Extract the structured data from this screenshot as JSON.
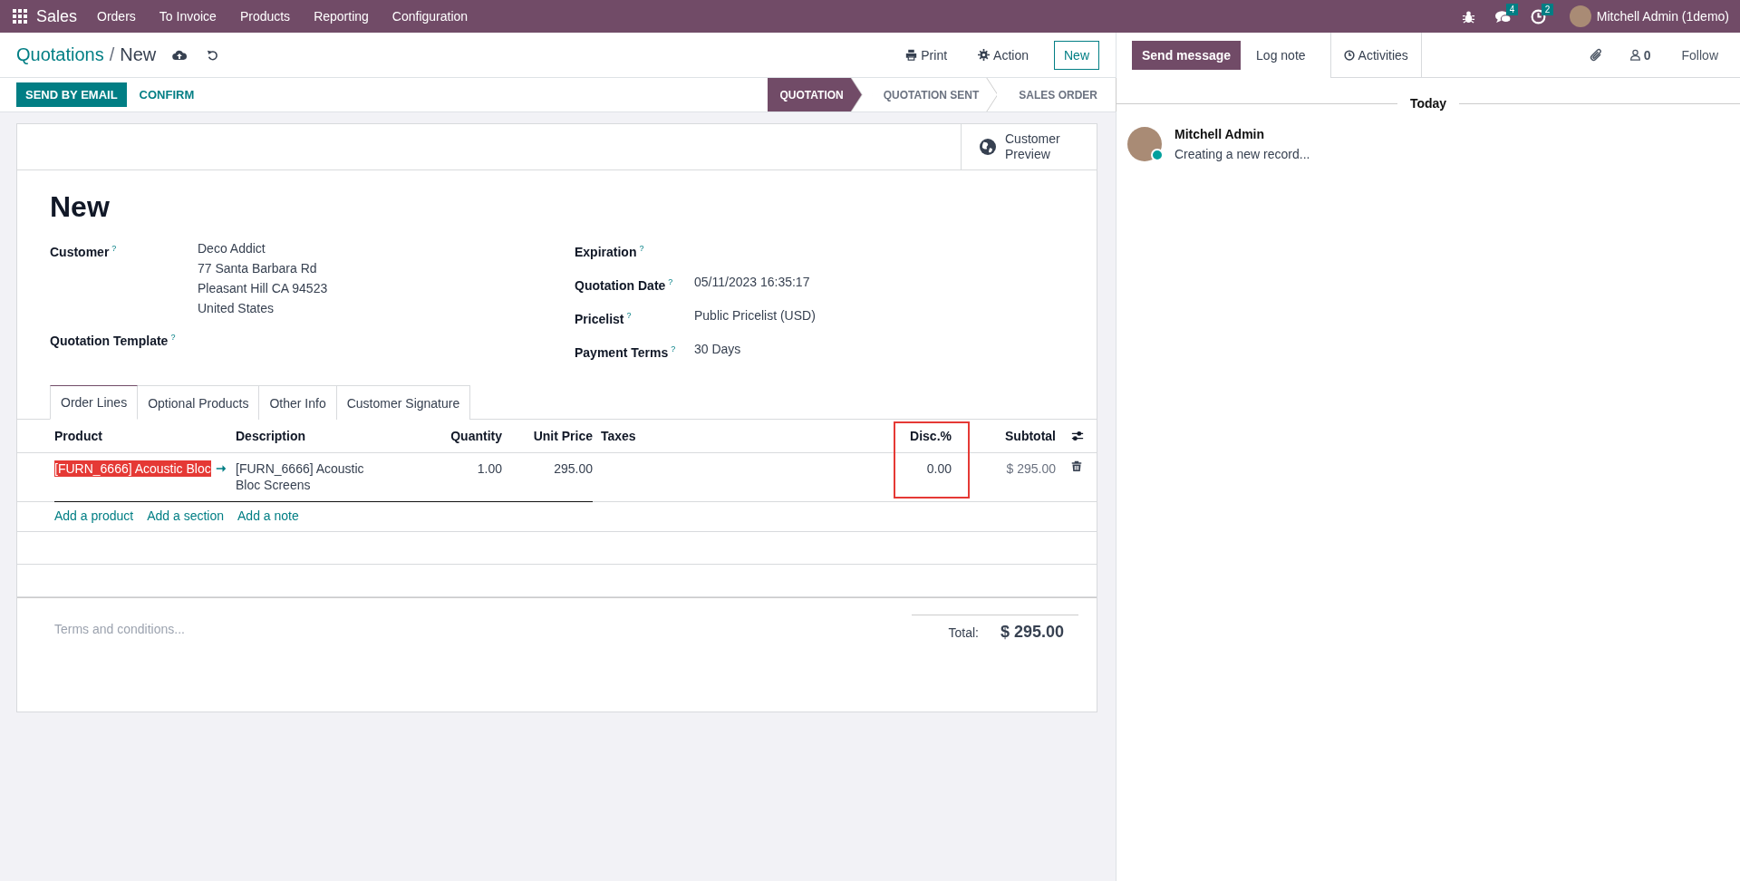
{
  "navbar": {
    "app": "Sales",
    "menu": [
      "Orders",
      "To Invoice",
      "Products",
      "Reporting",
      "Configuration"
    ],
    "badges": [
      {
        "kind": "messages",
        "count": "4"
      },
      {
        "kind": "activities",
        "count": "2"
      }
    ],
    "user": "Mitchell Admin (1demo)"
  },
  "breadcrumb": {
    "parent": "Quotations",
    "separator": "/",
    "current": "New"
  },
  "actions": {
    "print": "Print",
    "action": "Action",
    "new": "New"
  },
  "status_buttons": [
    {
      "label": "SEND BY EMAIL",
      "primary": true
    },
    {
      "label": "CONFIRM",
      "primary": false
    }
  ],
  "stages": [
    {
      "label": "QUOTATION",
      "selected": true
    },
    {
      "label": "QUOTATION SENT",
      "selected": false
    },
    {
      "label": "SALES ORDER",
      "selected": false
    }
  ],
  "button_box": {
    "label": "Customer Preview"
  },
  "title": "New",
  "left_fields": [
    {
      "label": "Customer",
      "help": "?",
      "value_lines": [
        "Deco Addict",
        "77 Santa Barbara Rd",
        "Pleasant Hill CA 94523",
        "United States"
      ]
    },
    {
      "label": "Quotation Template",
      "help": "?"
    }
  ],
  "right_fields": [
    {
      "label": "Expiration",
      "help": "?"
    },
    {
      "label": "Quotation Date",
      "help": "?",
      "value_lines": [
        "05/11/2023 16:35:17"
      ]
    },
    {
      "label": "Pricelist",
      "help": "?",
      "value_lines": [
        "Public Pricelist (USD)"
      ]
    },
    {
      "label": "Payment Terms",
      "help": "?",
      "value_lines": [
        "30 Days"
      ]
    }
  ],
  "tabs": [
    {
      "label": "Order Lines",
      "selected": true
    },
    {
      "label": "Optional Products",
      "selected": false
    },
    {
      "label": "Other Info",
      "selected": false
    },
    {
      "label": "Customer Signature",
      "selected": false
    }
  ],
  "table": {
    "columns": [
      {
        "label": "Product",
        "kind": "many2one",
        "highlighted": false
      },
      {
        "label": "Description",
        "kind": "text",
        "highlighted": false
      },
      {
        "label": "Quantity",
        "kind": "number",
        "highlighted": false
      },
      {
        "label": "Unit Price",
        "kind": "number",
        "highlighted": false
      },
      {
        "label": "Taxes",
        "kind": "tags",
        "highlighted": false
      },
      {
        "label": "Disc.%",
        "kind": "number",
        "highlighted": true
      },
      {
        "label": "Subtotal",
        "kind": "monetary",
        "highlighted": false
      }
    ],
    "rows": [
      {
        "cells": [
          {
            "text": "[FURN_6666] Acoustic Bloc",
            "selected": true
          },
          {
            "text": "[FURN_6666] Acoustic Bloc Screens"
          },
          {
            "text": "1.00"
          },
          {
            "text": "295.00"
          },
          {},
          {
            "text": "0.00"
          },
          {
            "text": "$ 295.00"
          }
        ]
      }
    ],
    "add_links": [
      "Add a product",
      "Add a section",
      "Add a note"
    ]
  },
  "terms_placeholder": "Terms and conditions...",
  "total": {
    "label": "Total:",
    "value": "$ 295.00"
  },
  "chatter": {
    "tabs": [
      {
        "label": "Send message",
        "selected": true
      },
      {
        "label": "Log note",
        "selected": false
      }
    ],
    "activities": "Activities",
    "followers": "0",
    "follow": "Follow",
    "date_divider": "Today",
    "messages": [
      {
        "author": "Mitchell Admin",
        "body": "Creating a new record...",
        "online": true
      }
    ]
  }
}
